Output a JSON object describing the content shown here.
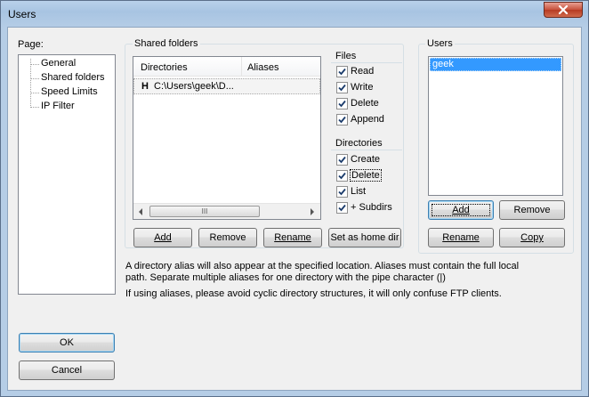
{
  "window": {
    "title": "Users",
    "close_label": "✕"
  },
  "page_panel": {
    "label": "Page:",
    "items": [
      "General",
      "Shared folders",
      "Speed Limits",
      "IP Filter"
    ],
    "selected": "Shared folders"
  },
  "shared_folders": {
    "group_label": "Shared folders",
    "columns": [
      "Directories",
      "Aliases"
    ],
    "rows": [
      {
        "home_marker": "H",
        "directory": "C:\\Users\\geek\\D...",
        "aliases": ""
      }
    ],
    "scrollbar_grip": "III",
    "buttons": {
      "add": "Add",
      "remove": "Remove",
      "rename": "Rename",
      "set_home": "Set as home dir"
    }
  },
  "files": {
    "label": "Files",
    "options": [
      {
        "label": "Read",
        "checked": true
      },
      {
        "label": "Write",
        "checked": true
      },
      {
        "label": "Delete",
        "checked": true
      },
      {
        "label": "Append",
        "checked": true
      }
    ]
  },
  "directories": {
    "label": "Directories",
    "options": [
      {
        "label": "Create",
        "checked": true
      },
      {
        "label": "Delete",
        "checked": true
      },
      {
        "label": "List",
        "checked": true
      },
      {
        "label": "+ Subdirs",
        "checked": true
      }
    ]
  },
  "users_panel": {
    "group_label": "Users",
    "items": [
      "geek"
    ],
    "selected": "geek",
    "buttons": {
      "add": "Add",
      "remove": "Remove",
      "rename": "Rename",
      "copy": "Copy"
    }
  },
  "help_text": {
    "line1": "A directory alias will also appear at the specified location. Aliases must contain the full local",
    "line2": "path. Separate multiple aliases for one directory with the pipe character (|)",
    "line3": "If using aliases, please avoid cyclic directory structures, it will only confuse FTP clients."
  },
  "dialog_buttons": {
    "ok": "OK",
    "cancel": "Cancel"
  },
  "colors": {
    "selection": "#3399ff",
    "accent_border": "#3c7fb1"
  }
}
